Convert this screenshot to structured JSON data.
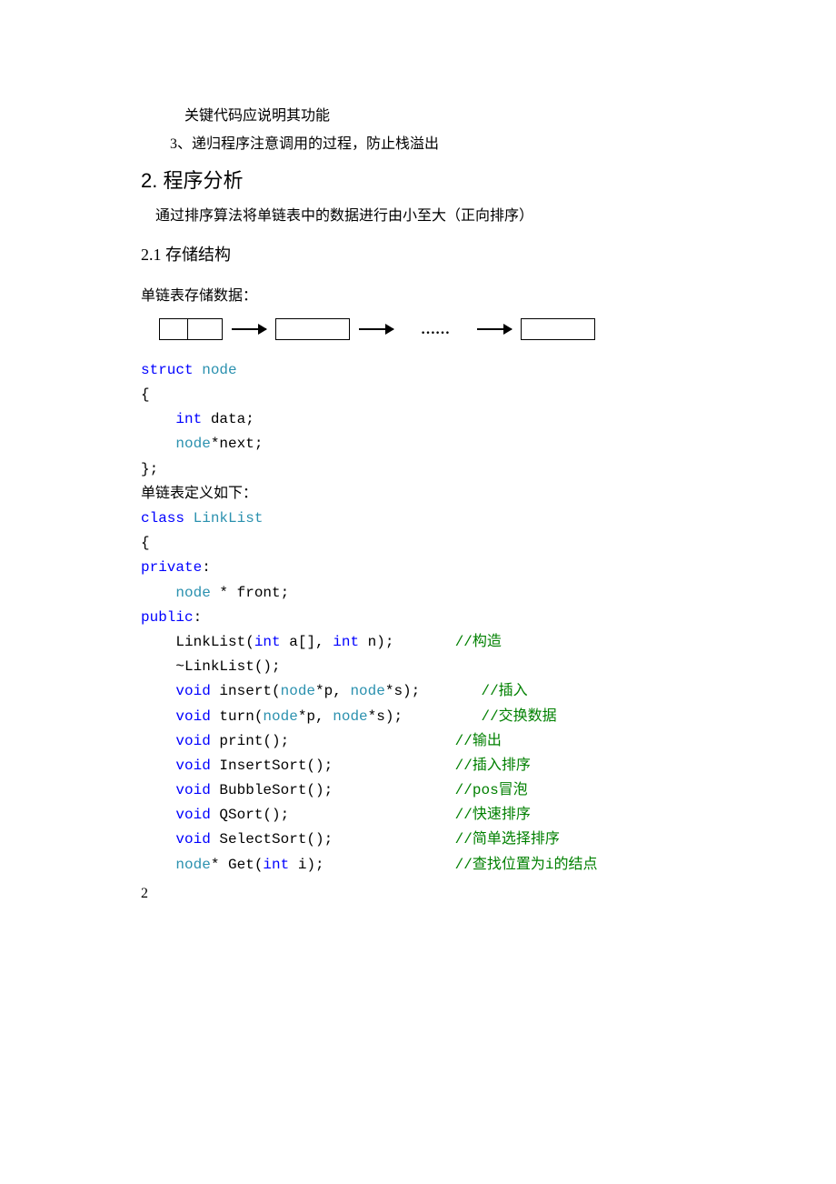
{
  "intro": {
    "line1": "关键代码应说明其功能",
    "line2": "3、递归程序注意调用的过程，防止栈溢出"
  },
  "section2": {
    "heading": "2. 程序分析",
    "desc": "通过排序算法将单链表中的数据进行由小至大（正向排序）"
  },
  "section21": {
    "heading": "2.1 存储结构",
    "label": "单链表存储数据：",
    "ellipsis": "……"
  },
  "code": {
    "kw_struct": "struct",
    "ty_node": "node",
    "lbrace": "{",
    "indent": "    ",
    "kw_int": "int",
    "data_decl": " data;",
    "next_decl": "*next;",
    "rbrace_semi": "};",
    "def_label": "单链表定义如下：",
    "kw_class": "class",
    "ty_linklist": "LinkList",
    "kw_private": "private",
    "colon": ":",
    "front_decl": " * front;",
    "kw_public": "public",
    "ctor1": "    LinkList(",
    "arr": " a[], ",
    "n_close": " n);       ",
    "cm_ctor": "//构造",
    "dtor": "    ~LinkList();",
    "kw_void": "void",
    "insert1": " insert(",
    "star_p": "*p, ",
    "star_s": "*s);       ",
    "cm_insert": "//插入",
    "turn1": " turn(",
    "cm_turn": "//交换数据",
    "print1": " print();                   ",
    "cm_print": "//输出",
    "isort": " InsertSort();              ",
    "cm_isort": "//插入排序",
    "bsort": " BubbleSort();              ",
    "cm_bsort": "//pos冒泡",
    "qsort": " QSort();                   ",
    "cm_qsort": "//快速排序",
    "ssort": " SelectSort();              ",
    "cm_ssort": "//简单选择排序",
    "get1": "* Get(",
    "get2": " i);               ",
    "cm_get": "//查找位置为i的结点"
  },
  "pageNumber": "2"
}
